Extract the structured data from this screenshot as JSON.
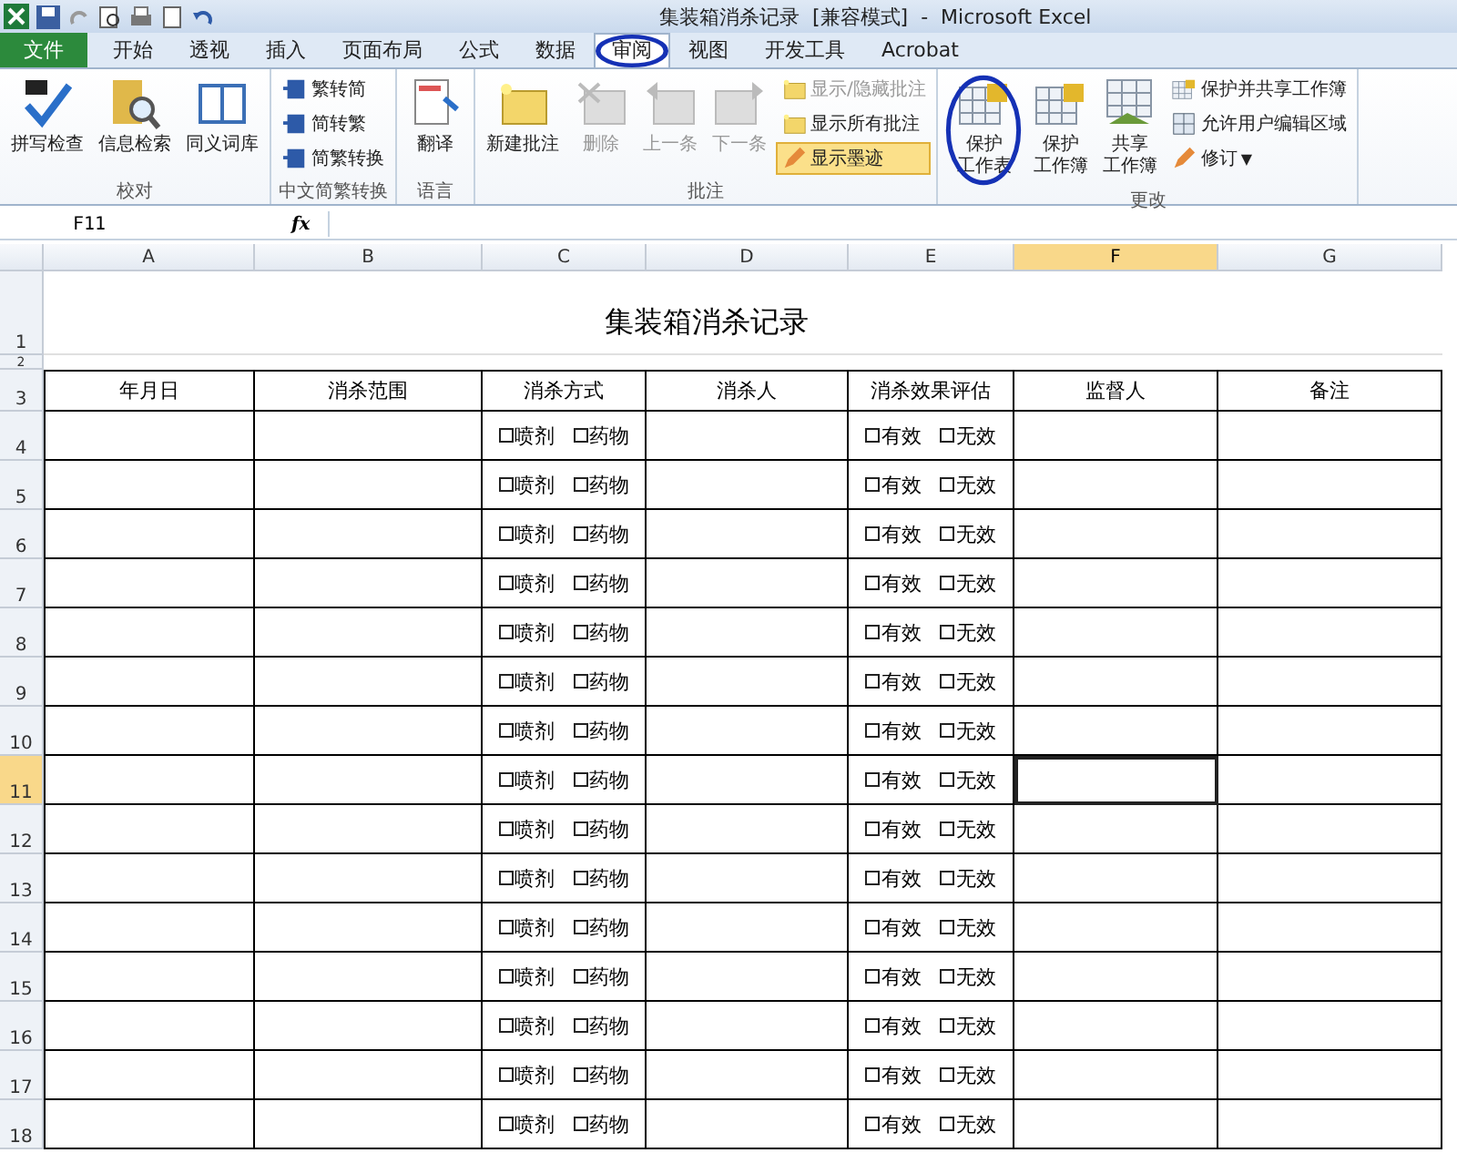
{
  "window": {
    "title": "集装箱消杀记录  [兼容模式]  -  Microsoft Excel"
  },
  "tabs": [
    {
      "label": "文件",
      "kind": "file",
      "selected": false
    },
    {
      "label": "开始",
      "kind": "tab",
      "selected": false
    },
    {
      "label": "透视",
      "kind": "tab",
      "selected": false
    },
    {
      "label": "插入",
      "kind": "tab",
      "selected": false
    },
    {
      "label": "页面布局",
      "kind": "tab",
      "selected": false
    },
    {
      "label": "公式",
      "kind": "tab",
      "selected": false
    },
    {
      "label": "数据",
      "kind": "tab",
      "selected": false
    },
    {
      "label": "审阅",
      "kind": "tab",
      "selected": true
    },
    {
      "label": "视图",
      "kind": "tab",
      "selected": false
    },
    {
      "label": "开发工具",
      "kind": "tab",
      "selected": false
    },
    {
      "label": "Acrobat",
      "kind": "tab",
      "selected": false
    }
  ],
  "ribbon": [
    {
      "label": "校对",
      "buttons": [
        {
          "label": "拼写检查",
          "kind": "large",
          "disabled": false
        },
        {
          "label": "信息检索",
          "kind": "large",
          "disabled": false
        },
        {
          "label": "同义词库",
          "kind": "large",
          "disabled": false
        }
      ]
    },
    {
      "label": "中文简繁转换",
      "buttons": [
        {
          "label": "繁转简",
          "kind": "small",
          "disabled": false
        },
        {
          "label": "简转繁",
          "kind": "small",
          "disabled": false
        },
        {
          "label": "简繁转换",
          "kind": "small",
          "disabled": false
        }
      ]
    },
    {
      "label": "语言",
      "buttons": [
        {
          "label": "翻译",
          "kind": "large",
          "disabled": false
        }
      ]
    },
    {
      "label": "批注",
      "buttons": [
        {
          "label": "新建批注",
          "kind": "large",
          "disabled": false
        },
        {
          "label": "删除",
          "kind": "large",
          "disabled": true
        },
        {
          "label": "上一条",
          "kind": "large",
          "disabled": true
        },
        {
          "label": "下一条",
          "kind": "large",
          "disabled": true
        },
        {
          "label": "显示/隐藏批注",
          "kind": "small",
          "disabled": true
        },
        {
          "label": "显示所有批注",
          "kind": "small",
          "disabled": false
        },
        {
          "label": "显示墨迹",
          "kind": "small",
          "disabled": false,
          "selected": true
        }
      ]
    },
    {
      "label": "更改",
      "buttons": [
        {
          "lines": [
            "保护",
            "工作表"
          ],
          "kind": "large",
          "disabled": false
        },
        {
          "lines": [
            "保护",
            "工作簿"
          ],
          "kind": "large",
          "disabled": false
        },
        {
          "lines": [
            "共享",
            "工作簿"
          ],
          "kind": "large",
          "disabled": false
        },
        {
          "label": "保护并共享工作簿",
          "kind": "small",
          "disabled": false
        },
        {
          "label": "允许用户编辑区域",
          "kind": "small",
          "disabled": false
        },
        {
          "label": "修订",
          "kind": "small",
          "disabled": false,
          "dropdown": "▼"
        }
      ]
    }
  ],
  "formula_bar": {
    "name_box": "F11",
    "fx": "fx"
  },
  "columns": [
    {
      "label": "A",
      "selected": false
    },
    {
      "label": "B",
      "selected": false
    },
    {
      "label": "C",
      "selected": false
    },
    {
      "label": "D",
      "selected": false
    },
    {
      "label": "E",
      "selected": false
    },
    {
      "label": "F",
      "selected": true
    },
    {
      "label": "G",
      "selected": false
    }
  ],
  "sheet": {
    "title_row": "1",
    "title": "集装箱消杀记录",
    "blank_row": "2",
    "header_row": "3",
    "headers": [
      "年月日",
      "消杀范围",
      "消杀方式",
      "消杀人",
      "消杀效果评估",
      "监督人",
      "备注"
    ],
    "rows": [
      {
        "num": "4",
        "method": [
          {
            "label": "喷剂",
            "checked": false
          },
          {
            "label": "药物",
            "checked": false
          }
        ],
        "effect": [
          {
            "label": "有效",
            "checked": false
          },
          {
            "label": "无效",
            "checked": false
          }
        ],
        "selected": false
      },
      {
        "num": "5",
        "method": [
          {
            "label": "喷剂",
            "checked": false
          },
          {
            "label": "药物",
            "checked": false
          }
        ],
        "effect": [
          {
            "label": "有效",
            "checked": false
          },
          {
            "label": "无效",
            "checked": false
          }
        ],
        "selected": false
      },
      {
        "num": "6",
        "method": [
          {
            "label": "喷剂",
            "checked": false
          },
          {
            "label": "药物",
            "checked": false
          }
        ],
        "effect": [
          {
            "label": "有效",
            "checked": false
          },
          {
            "label": "无效",
            "checked": false
          }
        ],
        "selected": false
      },
      {
        "num": "7",
        "method": [
          {
            "label": "喷剂",
            "checked": false
          },
          {
            "label": "药物",
            "checked": false
          }
        ],
        "effect": [
          {
            "label": "有效",
            "checked": false
          },
          {
            "label": "无效",
            "checked": false
          }
        ],
        "selected": false
      },
      {
        "num": "8",
        "method": [
          {
            "label": "喷剂",
            "checked": false
          },
          {
            "label": "药物",
            "checked": false
          }
        ],
        "effect": [
          {
            "label": "有效",
            "checked": false
          },
          {
            "label": "无效",
            "checked": false
          }
        ],
        "selected": false
      },
      {
        "num": "9",
        "method": [
          {
            "label": "喷剂",
            "checked": false
          },
          {
            "label": "药物",
            "checked": false
          }
        ],
        "effect": [
          {
            "label": "有效",
            "checked": false
          },
          {
            "label": "无效",
            "checked": false
          }
        ],
        "selected": false
      },
      {
        "num": "10",
        "method": [
          {
            "label": "喷剂",
            "checked": false
          },
          {
            "label": "药物",
            "checked": false
          }
        ],
        "effect": [
          {
            "label": "有效",
            "checked": false
          },
          {
            "label": "无效",
            "checked": false
          }
        ],
        "selected": false
      },
      {
        "num": "11",
        "method": [
          {
            "label": "喷剂",
            "checked": false
          },
          {
            "label": "药物",
            "checked": false
          }
        ],
        "effect": [
          {
            "label": "有效",
            "checked": false
          },
          {
            "label": "无效",
            "checked": false
          }
        ],
        "selected": true
      },
      {
        "num": "12",
        "method": [
          {
            "label": "喷剂",
            "checked": false
          },
          {
            "label": "药物",
            "checked": false
          }
        ],
        "effect": [
          {
            "label": "有效",
            "checked": false
          },
          {
            "label": "无效",
            "checked": false
          }
        ],
        "selected": false
      },
      {
        "num": "13",
        "method": [
          {
            "label": "喷剂",
            "checked": false
          },
          {
            "label": "药物",
            "checked": false
          }
        ],
        "effect": [
          {
            "label": "有效",
            "checked": false
          },
          {
            "label": "无效",
            "checked": false
          }
        ],
        "selected": false
      },
      {
        "num": "14",
        "method": [
          {
            "label": "喷剂",
            "checked": false
          },
          {
            "label": "药物",
            "checked": false
          }
        ],
        "effect": [
          {
            "label": "有效",
            "checked": false
          },
          {
            "label": "无效",
            "checked": false
          }
        ],
        "selected": false
      },
      {
        "num": "15",
        "method": [
          {
            "label": "喷剂",
            "checked": false
          },
          {
            "label": "药物",
            "checked": false
          }
        ],
        "effect": [
          {
            "label": "有效",
            "checked": false
          },
          {
            "label": "无效",
            "checked": false
          }
        ],
        "selected": false
      },
      {
        "num": "16",
        "method": [
          {
            "label": "喷剂",
            "checked": false
          },
          {
            "label": "药物",
            "checked": false
          }
        ],
        "effect": [
          {
            "label": "有效",
            "checked": false
          },
          {
            "label": "无效",
            "checked": false
          }
        ],
        "selected": false
      },
      {
        "num": "17",
        "method": [
          {
            "label": "喷剂",
            "checked": false
          },
          {
            "label": "药物",
            "checked": false
          }
        ],
        "effect": [
          {
            "label": "有效",
            "checked": false
          },
          {
            "label": "无效",
            "checked": false
          }
        ],
        "selected": false
      },
      {
        "num": "18",
        "method": [
          {
            "label": "喷剂",
            "checked": false
          },
          {
            "label": "药物",
            "checked": false
          }
        ],
        "effect": [
          {
            "label": "有效",
            "checked": false
          },
          {
            "label": "无效",
            "checked": false
          }
        ],
        "selected": false
      }
    ]
  }
}
